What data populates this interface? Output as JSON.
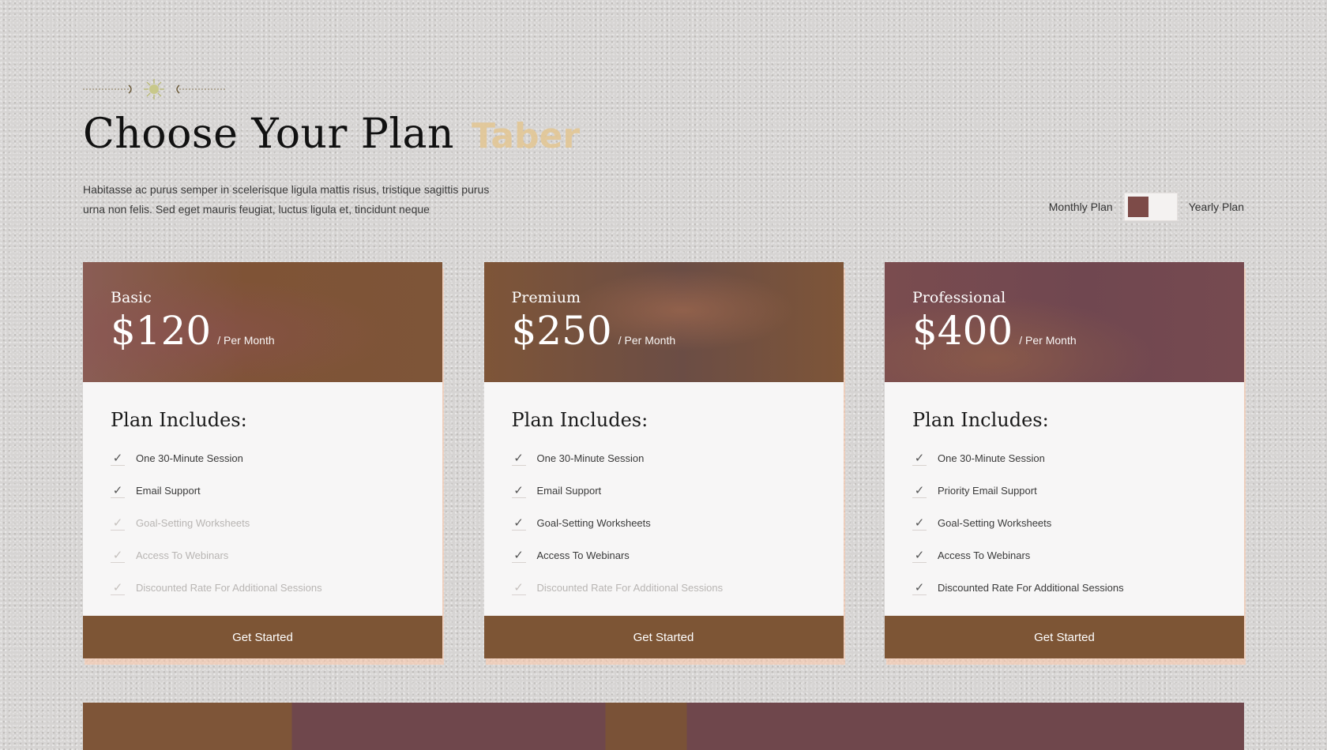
{
  "header": {
    "title": "Choose Your Plan",
    "title_accent": "Taber",
    "description": "Habitasse ac purus semper in scelerisque ligula mattis risus, tristique sagittis purus urna non felis. Sed eget mauris feugiat, luctus ligula et, tincidunt neque"
  },
  "billing_toggle": {
    "monthly_label": "Monthly Plan",
    "yearly_label": "Yearly Plan",
    "selected": "Monthly Plan"
  },
  "plans": [
    {
      "name": "Basic",
      "price": "$120",
      "period": "/ Per Month",
      "includes_title": "Plan Includes:",
      "features": [
        {
          "label": "One 30-Minute Session",
          "enabled": true
        },
        {
          "label": "Email Support",
          "enabled": true
        },
        {
          "label": "Goal-Setting Worksheets",
          "enabled": false
        },
        {
          "label": "Access To Webinars",
          "enabled": false
        },
        {
          "label": "Discounted Rate For Additional Sessions",
          "enabled": false
        }
      ],
      "cta": "Get Started"
    },
    {
      "name": "Premium",
      "price": "$250",
      "period": "/ Per Month",
      "includes_title": "Plan Includes:",
      "features": [
        {
          "label": "One 30-Minute Session",
          "enabled": true
        },
        {
          "label": "Email Support",
          "enabled": true
        },
        {
          "label": "Goal-Setting Worksheets",
          "enabled": true
        },
        {
          "label": "Access To Webinars",
          "enabled": true
        },
        {
          "label": "Discounted Rate For Additional Sessions",
          "enabled": false
        }
      ],
      "cta": "Get Started"
    },
    {
      "name": "Professional",
      "price": "$400",
      "period": "/ Per Month",
      "includes_title": "Plan Includes:",
      "features": [
        {
          "label": "One 30-Minute Session",
          "enabled": true
        },
        {
          "label": "Priority Email Support",
          "enabled": true
        },
        {
          "label": "Goal-Setting Worksheets",
          "enabled": true
        },
        {
          "label": "Access To Webinars",
          "enabled": true
        },
        {
          "label": "Discounted Rate For Additional Sessions",
          "enabled": true
        }
      ],
      "cta": "Get Started"
    }
  ],
  "icons": {
    "ornament": "sun-ornament-icon",
    "feature_check": "check-icon"
  },
  "colors": {
    "accent_brown": "#7d5535",
    "accent_mauve": "#7d4b48",
    "title_accent": "#e3c796",
    "card_body": "#f7f6f6",
    "page_background": "#d6d4d3"
  }
}
